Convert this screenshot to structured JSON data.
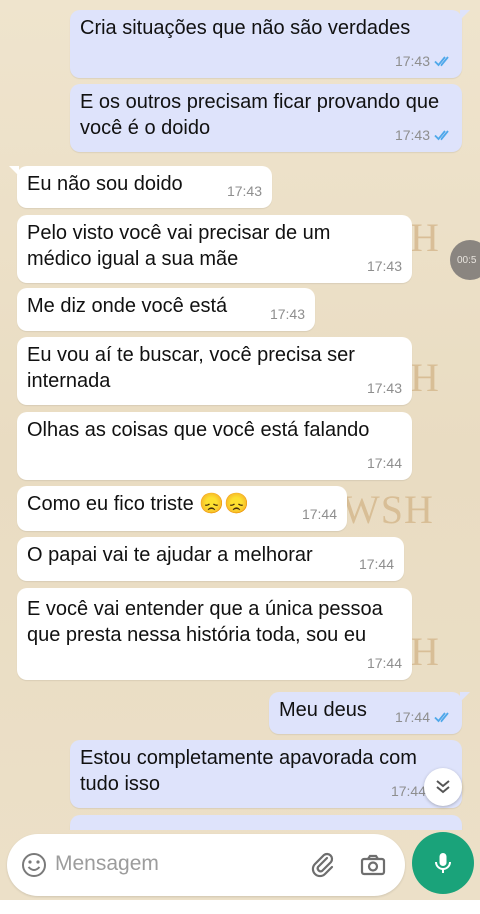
{
  "watermark": {
    "text": "WSH",
    "single": "H"
  },
  "timer_label": "00:5",
  "messages": [
    {
      "dir": "out",
      "text": "Cria situações que não são verdades",
      "time": "17:43"
    },
    {
      "dir": "out",
      "text": "E os outros precisam ficar provando que\nvocê é o doido",
      "time": "17:43"
    },
    {
      "dir": "in",
      "text": "Eu não sou doido",
      "time": "17:43"
    },
    {
      "dir": "in",
      "text": "Pelo visto você vai precisar de um\nmédico igual a sua mãe",
      "time": "17:43"
    },
    {
      "dir": "in",
      "text": "Me diz onde você está",
      "time": "17:43"
    },
    {
      "dir": "in",
      "text": "Eu vou aí te buscar, você precisa ser\ninternada",
      "time": "17:43"
    },
    {
      "dir": "in",
      "text": "Olhas as coisas que você está falando",
      "time": "17:44"
    },
    {
      "dir": "in",
      "text": "Como eu fico triste 😞😞",
      "time": "17:44"
    },
    {
      "dir": "in",
      "text": "O papai vai te ajudar a melhorar",
      "time": "17:44"
    },
    {
      "dir": "in",
      "text": "E você vai entender que a única pessoa\nque presta nessa história toda, sou eu",
      "time": "17:44"
    },
    {
      "dir": "out",
      "text": "Meu deus",
      "time": "17:44"
    },
    {
      "dir": "out",
      "text": "Estou completamente apavorada com\ntudo isso",
      "time": "17:44"
    }
  ],
  "composer": {
    "placeholder": "Mensagem"
  },
  "icons": {
    "emoji": "emoji-icon",
    "attach": "paperclip-icon",
    "camera": "camera-icon",
    "mic": "microphone-icon",
    "scroll": "double-chevron-down-icon",
    "read": "double-check-icon"
  },
  "colors": {
    "outgoing_bubble": "#dee3fb",
    "incoming_bubble": "#ffffff",
    "read_tick": "#4fa8ea",
    "mic_button": "#1aa37a",
    "wallpaper": "#ece0c8"
  }
}
